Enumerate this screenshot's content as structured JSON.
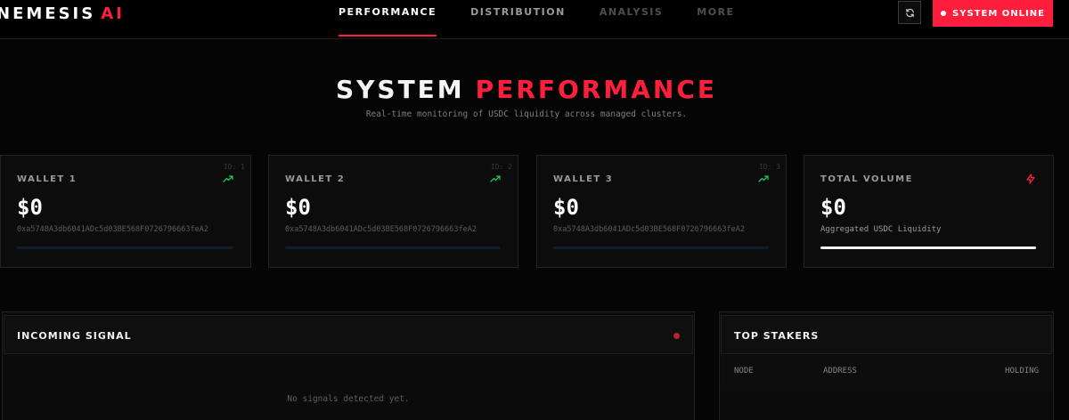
{
  "header": {
    "brand_main": "NEMESIS",
    "brand_accent": "AI",
    "nav": [
      {
        "label": "PERFORMANCE"
      },
      {
        "label": "DISTRIBUTION"
      },
      {
        "label": "ANALYSIS"
      },
      {
        "label": "MORE"
      }
    ],
    "status_label": "SYSTEM ONLINE"
  },
  "hero": {
    "title_white": "SYSTEM",
    "title_red": "PERFORMANCE",
    "subtitle": "Real-time monitoring of USDC liquidity across managed clusters."
  },
  "wallets": [
    {
      "id": "ID: 1",
      "label": "WALLET 1",
      "amount": "$0",
      "address": "0xa5748A3db6041ADc5d03BE568F0726796663feA2"
    },
    {
      "id": "ID: 2",
      "label": "WALLET 2",
      "amount": "$0",
      "address": "0xa5748A3db6041ADc5d03BE568F0726796663feA2"
    },
    {
      "id": "ID: 3",
      "label": "WALLET 3",
      "amount": "$0",
      "address": "0xa5748A3db6041ADc5d03BE568F0726796663feA2"
    }
  ],
  "total": {
    "label": "TOTAL VOLUME",
    "amount": "$0",
    "note": "Aggregated USDC Liquidity"
  },
  "signals": {
    "title": "INCOMING SIGNAL",
    "empty": "No signals detected yet."
  },
  "stakers": {
    "title": "TOP STAKERS",
    "columns": [
      "NODE",
      "ADDRESS",
      "HOLDING"
    ]
  },
  "colors": {
    "accent": "#ff1f3d",
    "positive": "#22c55e",
    "background": "#050505"
  },
  "icons": {
    "refresh": "refresh-icon",
    "wallet_trend": "trending-up-icon",
    "total": "activity-icon"
  }
}
